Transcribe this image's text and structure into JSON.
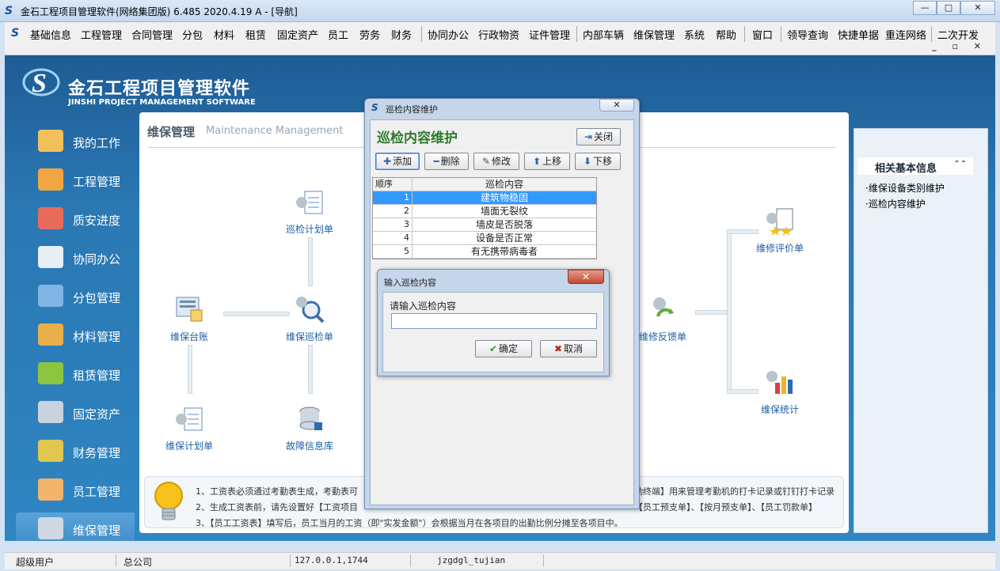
{
  "window": {
    "title": "金石工程项目管理软件(网络集团版) 6.485  2020.4.19 A - [导航]",
    "buttons": {
      "minimize": "—",
      "maximize": "□",
      "close": "✕"
    }
  },
  "menu": {
    "items": [
      "基础信息",
      "工程管理",
      "合同管理",
      "分包",
      "材料",
      "租赁",
      "固定资产",
      "员工",
      "劳务",
      "财务",
      "协同办公",
      "行政物资",
      "证件管理",
      "内部车辆",
      "维保管理",
      "系统",
      "帮助",
      "窗口",
      "领导查询",
      "快捷单据",
      "重连网络",
      "二次开发"
    ],
    "mdi_buttons": "_ ▫ ✕"
  },
  "brand": {
    "cn": "金石工程项目管理软件",
    "en": "JINSHI PROJECT MANAGEMENT SOFTWARE"
  },
  "sidebar": {
    "items": [
      {
        "label": "我的工作",
        "icon": "folder-user-icon"
      },
      {
        "label": "工程管理",
        "icon": "worker-icon"
      },
      {
        "label": "质安进度",
        "icon": "clock-chart-icon"
      },
      {
        "label": "协同办公",
        "icon": "office-icon"
      },
      {
        "label": "分包管理",
        "icon": "layers-icon"
      },
      {
        "label": "材料管理",
        "icon": "box-icon"
      },
      {
        "label": "租赁管理",
        "icon": "cube-icon"
      },
      {
        "label": "固定资产",
        "icon": "server-icon"
      },
      {
        "label": "财务管理",
        "icon": "money-icon"
      },
      {
        "label": "员工管理",
        "icon": "people-icon"
      },
      {
        "label": "维保管理",
        "icon": "wrench-icon"
      }
    ]
  },
  "panel": {
    "title": "维保管理",
    "subtitle": "Maintenance Management"
  },
  "flow": {
    "ledger": "维保台账",
    "inspect_plan": "巡检计划单",
    "inspect": "维保巡检单",
    "maint_plan": "维保计划单",
    "fault_db": "故障信息库",
    "feedback": "维修反馈单",
    "evaluate": "维修评价单",
    "stats": "维保统计"
  },
  "tips": [
    "1、工资表必须通过考勤表生成，考勤表可",
    "2、生成工资表前，请先设置好【工资项目",
    "3、【员工工资表】填写后，员工当月的工资（即\"实发金额\"）会根据当月在各项目的出勤比例分摊至各项目中。"
  ],
  "tips_right": [
    "勤终端】用来管理考勤机的打卡记录或钉钉打卡记录",
    "【员工预支单】、【按月预支单】、【员工罚款单】"
  ],
  "right_panel": {
    "title": "相关基本信息",
    "links": [
      "·维保设备类别维护",
      "·巡检内容维护"
    ]
  },
  "dialog_main": {
    "window_title": "巡检内容维护",
    "heading": "巡检内容维护",
    "close_label": "关闭",
    "buttons": {
      "add": "添加",
      "delete": "删除",
      "edit": "修改",
      "up": "上移",
      "down": "下移"
    },
    "grid": {
      "columns": [
        "顺序",
        "巡检内容"
      ],
      "rows": [
        {
          "order": "1",
          "content": "建筑物稳固"
        },
        {
          "order": "2",
          "content": "墙面无裂纹"
        },
        {
          "order": "3",
          "content": "墙皮是否脱落"
        },
        {
          "order": "4",
          "content": "设备是否正常"
        },
        {
          "order": "5",
          "content": "有无携带病毒者"
        }
      ],
      "selected_index": 0
    }
  },
  "dialog_input": {
    "window_title": "输入巡检内容",
    "prompt": "请输入巡检内容",
    "value": "",
    "ok_label": "确定",
    "cancel_label": "取消"
  },
  "status": {
    "user": "超级用户",
    "company": "总公司",
    "server": "127.0.0.1,1744",
    "db": "jzgdgl_tujian"
  },
  "colors": {
    "client_bg": "#2a77b3",
    "selected_row": "#3399ff",
    "heading_green": "#2d7a2d",
    "flow_label": "#1d5fa6"
  }
}
